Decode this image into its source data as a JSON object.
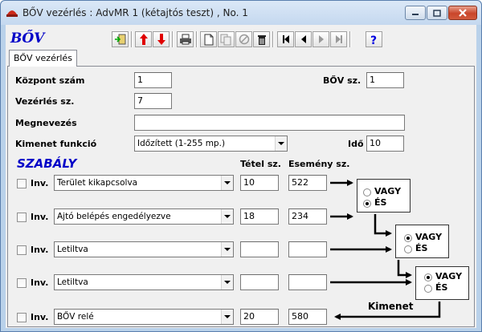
{
  "window": {
    "title": "BŐV vezérlés : AdvMR 1 (kétajtós teszt) , No. 1"
  },
  "logo": "BŐV",
  "tab": "BŐV vezérlés",
  "fields": {
    "kozpont_label": "Központ szám",
    "kozpont_value": "1",
    "bov_sz_label": "BŐV sz.",
    "bov_sz_value": "1",
    "vezerles_label": "Vezérlés sz.",
    "vezerles_value": "7",
    "megnevezes_label": "Megnevezés",
    "megnevezes_value": "",
    "kimenet_label": "Kimenet funkció",
    "kimenet_value": "Időzített (1-255 mp.)",
    "ido_label": "Idő",
    "ido_value": "10"
  },
  "rules": {
    "title": "SZABÁLY",
    "col_tetel": "Tétel sz.",
    "col_esemeny": "Esemény sz.",
    "inv_label": "Inv.",
    "rows": [
      {
        "event": "Terület kikapcsolva",
        "tetel": "10",
        "esemeny": "522"
      },
      {
        "event": "Ajtó belépés engedélyezve",
        "tetel": "18",
        "esemeny": "234"
      },
      {
        "event": "Letiltva",
        "tetel": "",
        "esemeny": ""
      },
      {
        "event": "Letiltva",
        "tetel": "",
        "esemeny": ""
      },
      {
        "event": "BŐV relé",
        "tetel": "20",
        "esemeny": "580"
      }
    ]
  },
  "logic": {
    "vagy": "VAGY",
    "es": "ÉS",
    "ops": [
      "ÉS",
      "VAGY",
      "VAGY"
    ]
  },
  "kimenet_caption": "Kimenet",
  "colors": {
    "accent_blue": "#0000c8",
    "up_red": "#e00000"
  }
}
